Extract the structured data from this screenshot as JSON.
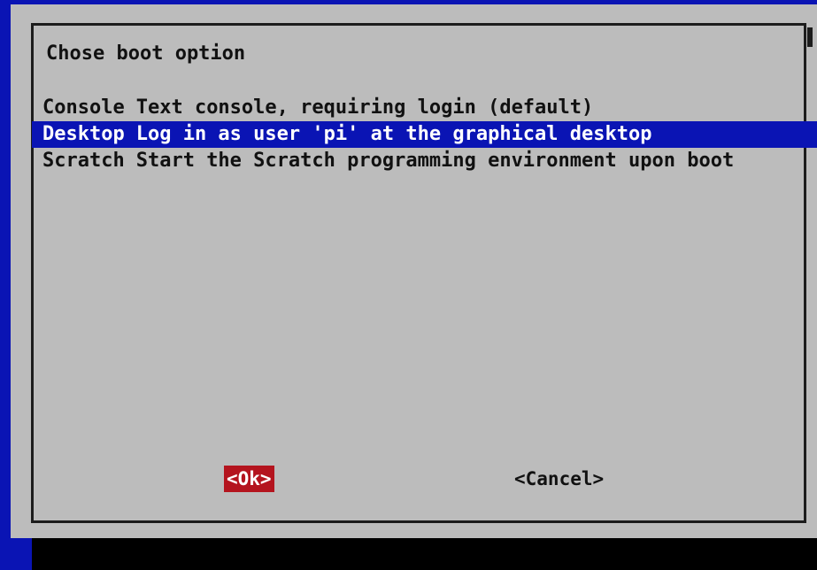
{
  "dialog": {
    "title": "Chose boot option"
  },
  "menu": {
    "items": [
      {
        "key": "Console",
        "description": "Text console, requiring login (default)",
        "selected": false
      },
      {
        "key": "Desktop",
        "description": "Log in as user 'pi' at the graphical desktop",
        "selected": true
      },
      {
        "key": "Scratch",
        "description": "Start the Scratch programming environment upon boot",
        "selected": false
      }
    ]
  },
  "buttons": {
    "ok_label": "<Ok>",
    "cancel_label": "<Cancel>"
  },
  "colors": {
    "background": "#0a14b4",
    "dialog": "#bcbcbc",
    "highlight": "#0a14b4",
    "button_focus": "#b4141e"
  }
}
